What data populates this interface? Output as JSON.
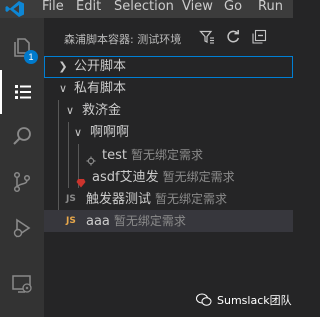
{
  "menubar": {
    "items": [
      "File",
      "Edit",
      "Selection",
      "View",
      "Go",
      "Run"
    ]
  },
  "activity_bar": {
    "explorer_badge": "1"
  },
  "panel": {
    "title": "森浦脚本容器: 测试环境"
  },
  "tree": [
    {
      "label": "公开脚本",
      "desc": "",
      "icon": "",
      "expanded": false
    },
    {
      "label": "私有脚本",
      "desc": "",
      "icon": "",
      "expanded": true
    },
    {
      "label": "救济金",
      "desc": "",
      "icon": "",
      "expanded": true
    },
    {
      "label": "啊啊啊",
      "desc": "",
      "icon": "",
      "expanded": true
    },
    {
      "label": "test",
      "desc": "暂无绑定需求",
      "icon": "gear"
    },
    {
      "label": "asdf艾迪发",
      "desc": "暂无绑定需求",
      "icon": "ruby"
    },
    {
      "label": "触发器测试",
      "desc": "暂无绑定需求",
      "icon": "JS"
    },
    {
      "label": "aaa",
      "desc": "暂无绑定需求",
      "icon": "JS"
    }
  ],
  "watermark": {
    "text": "Sumslack团队"
  },
  "colors": {
    "accent": "#007acc",
    "js_gray": "#8a8a8a",
    "js_orange": "#e8a84b",
    "ruby": "#cc342d"
  }
}
